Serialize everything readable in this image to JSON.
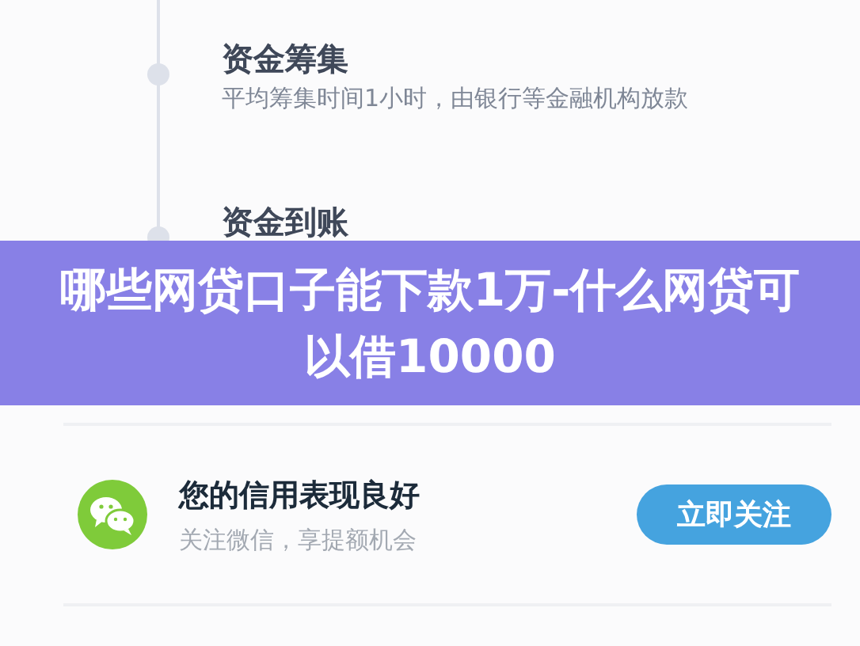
{
  "steps": [
    {
      "title": "资金筹集",
      "description": "平均筹集时间1小时，由银行等金融机构放款"
    },
    {
      "title": "资金到账"
    }
  ],
  "banner": {
    "title": "哪些网贷口子能下款1万-什么网贷可以借10000"
  },
  "promo": {
    "title": "您的信用表现良好",
    "subtitle": "关注微信，享提额机会",
    "button": "立即关注"
  }
}
